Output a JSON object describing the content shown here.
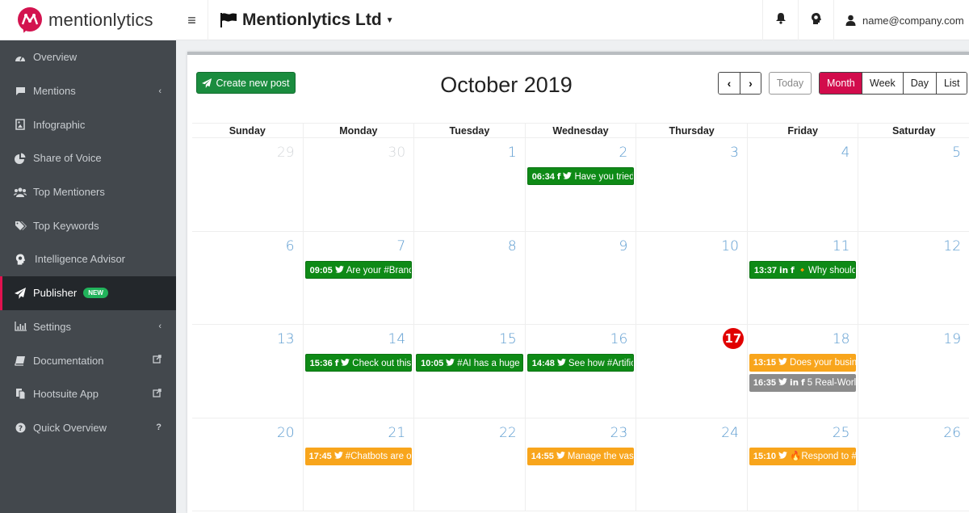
{
  "app": {
    "logo_text": "mentionlytics",
    "organization": "Mentionlytics Ltd",
    "user_email": "name@company.com",
    "brand_color": "#d3134f"
  },
  "topbar": {
    "menu_icon": "hamburger-icon",
    "icons": [
      "bell-icon",
      "brain-icon",
      "user-icon"
    ]
  },
  "sidebar": {
    "items": [
      {
        "label": "Overview",
        "icon": "dashboard-icon",
        "trail": ""
      },
      {
        "label": "Mentions",
        "icon": "comment-icon",
        "trail": "‹"
      },
      {
        "label": "Infographic",
        "icon": "image-icon",
        "trail": ""
      },
      {
        "label": "Share of Voice",
        "icon": "pie-chart-icon",
        "trail": ""
      },
      {
        "label": "Top Mentioners",
        "icon": "users-icon",
        "trail": ""
      },
      {
        "label": "Top Keywords",
        "icon": "tags-icon",
        "trail": ""
      },
      {
        "label": "Intelligence Advisor",
        "icon": "brain-icon",
        "trail": ""
      },
      {
        "label": "Publisher",
        "icon": "paper-plane-icon",
        "trail": "",
        "badge": "NEW",
        "active": true
      },
      {
        "label": "Settings",
        "icon": "bar-chart-icon",
        "trail": "‹"
      },
      {
        "label": "Documentation",
        "icon": "book-icon",
        "trail": "external-link"
      },
      {
        "label": "Hootsuite App",
        "icon": "copy-icon",
        "trail": "external-link"
      },
      {
        "label": "Quick Overview",
        "icon": "question-icon",
        "trail": "?"
      }
    ]
  },
  "calendar": {
    "create_label": "Create new post",
    "title": "October 2019",
    "prev_label": "‹",
    "next_label": "›",
    "today_label": "Today",
    "views": [
      "Month",
      "Week",
      "Day",
      "List"
    ],
    "active_view": "Month",
    "weekdays": [
      "Sunday",
      "Monday",
      "Tuesday",
      "Wednesday",
      "Thursday",
      "Friday",
      "Saturday"
    ],
    "colors": {
      "published": "#0e8a16",
      "scheduled": "#f8a51c",
      "draft": "#8c8c8c",
      "today": "#e10000"
    },
    "weeks": [
      [
        {
          "day": "29",
          "other": true,
          "events": []
        },
        {
          "day": "30",
          "other": true,
          "events": []
        },
        {
          "day": "1",
          "events": []
        },
        {
          "day": "2",
          "events": [
            {
              "time": "06:34",
              "networks": [
                "facebook",
                "twitter"
              ],
              "text": "Have you tried",
              "status": "green"
            }
          ]
        },
        {
          "day": "3",
          "events": []
        },
        {
          "day": "4",
          "events": []
        },
        {
          "day": "5",
          "events": []
        }
      ],
      [
        {
          "day": "6",
          "events": []
        },
        {
          "day": "7",
          "events": [
            {
              "time": "09:05",
              "networks": [
                "twitter"
              ],
              "text": "Are your #Brand",
              "status": "green"
            }
          ]
        },
        {
          "day": "8",
          "events": []
        },
        {
          "day": "9",
          "events": []
        },
        {
          "day": "10",
          "events": []
        },
        {
          "day": "11",
          "events": [
            {
              "time": "13:37",
              "networks": [
                "linkedin",
                "facebook"
              ],
              "text": "🔸Why should",
              "status": "green"
            }
          ]
        },
        {
          "day": "12",
          "events": []
        }
      ],
      [
        {
          "day": "13",
          "events": []
        },
        {
          "day": "14",
          "events": [
            {
              "time": "15:36",
              "networks": [
                "facebook",
                "twitter"
              ],
              "text": "Check out this",
              "status": "green"
            }
          ]
        },
        {
          "day": "15",
          "events": [
            {
              "time": "10:05",
              "networks": [
                "twitter"
              ],
              "text": "#AI has a huge p",
              "status": "green"
            }
          ]
        },
        {
          "day": "16",
          "events": [
            {
              "time": "14:48",
              "networks": [
                "twitter"
              ],
              "text": "See how #Artific",
              "status": "green"
            }
          ]
        },
        {
          "day": "17",
          "today": true,
          "events": []
        },
        {
          "day": "18",
          "events": [
            {
              "time": "13:15",
              "networks": [
                "twitter"
              ],
              "text": "Does your busin",
              "status": "orange"
            },
            {
              "time": "16:35",
              "networks": [
                "twitter",
                "linkedin",
                "facebook"
              ],
              "text": "5 Real-Worl",
              "status": "gray"
            }
          ]
        },
        {
          "day": "19",
          "events": []
        }
      ],
      [
        {
          "day": "20",
          "events": []
        },
        {
          "day": "21",
          "events": [
            {
              "time": "17:45",
              "networks": [
                "twitter"
              ],
              "text": "#Chatbots are o",
              "status": "orange"
            }
          ]
        },
        {
          "day": "22",
          "events": []
        },
        {
          "day": "23",
          "events": [
            {
              "time": "14:55",
              "networks": [
                "twitter"
              ],
              "text": "Manage the vas",
              "status": "orange"
            }
          ]
        },
        {
          "day": "24",
          "events": []
        },
        {
          "day": "25",
          "events": [
            {
              "time": "15:10",
              "networks": [
                "twitter"
              ],
              "text": "🔥Respond to #",
              "status": "orange"
            }
          ]
        },
        {
          "day": "26",
          "events": []
        }
      ]
    ]
  }
}
